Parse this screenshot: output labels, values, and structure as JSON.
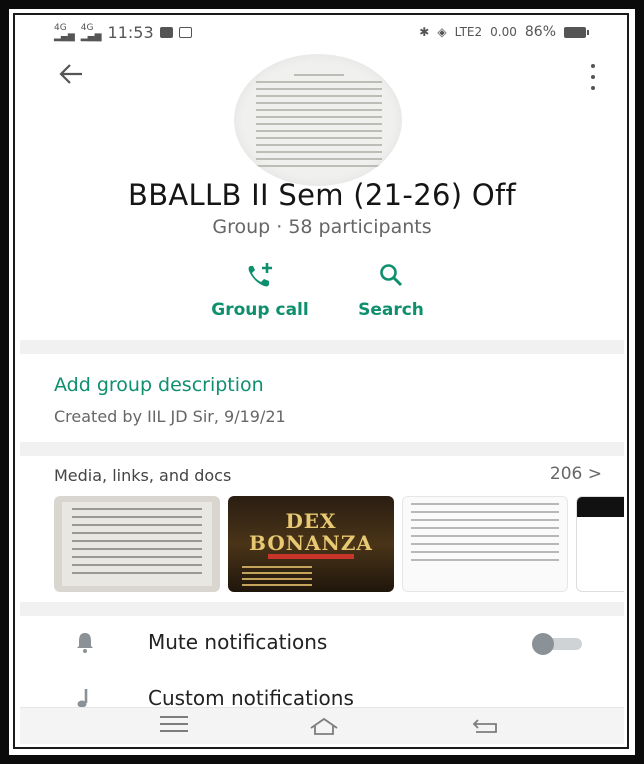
{
  "status_bar": {
    "signal_1": "4G",
    "signal_2": "4G",
    "time": "11:53",
    "network": "LTE2",
    "speed": "0.00",
    "battery": "86%"
  },
  "group": {
    "title": "BBALLB II Sem (21-26) Off",
    "subtitle": "Group · 58 participants"
  },
  "actions": {
    "call_label": "Group call",
    "search_label": "Search"
  },
  "description": {
    "add_label": "Add group description",
    "created": "Created by IIL JD Sir, 9/19/21"
  },
  "media": {
    "header": "Media, links, and docs",
    "count": "206 >",
    "thumb2_text": "DEX\nBONANZA"
  },
  "settings": [
    {
      "label": "Mute notifications",
      "icon": "bell-icon",
      "toggle": false
    },
    {
      "label": "Custom notifications",
      "icon": "music-note-icon"
    }
  ],
  "colors": {
    "accent": "#0e8f6e",
    "divider": "#f1f1f1"
  }
}
